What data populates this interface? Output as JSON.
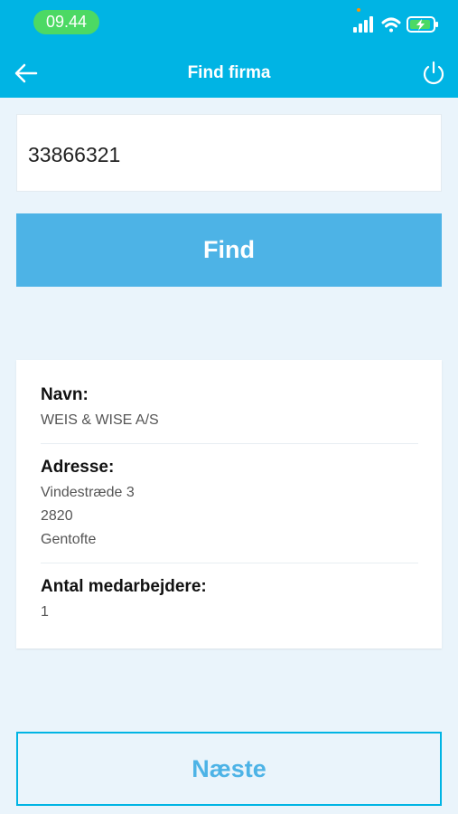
{
  "status_bar": {
    "time": "09.44",
    "icons": [
      "signal-icon",
      "wifi-icon",
      "battery-charging-icon"
    ],
    "time_pill_color": "#4cd964"
  },
  "header": {
    "title": "Find firma",
    "back_icon": "back-arrow-icon",
    "power_icon": "power-icon",
    "background": "#00b4e4"
  },
  "search": {
    "value": "33866321",
    "button_label": "Find"
  },
  "result": {
    "name_label": "Navn:",
    "name_value": "WEIS & WISE A/S",
    "address_label": "Adresse:",
    "address_lines": [
      "Vindestræde 3",
      "2820",
      "Gentofte"
    ],
    "employees_label": "Antal medarbejdere:",
    "employees_value": "1"
  },
  "footer": {
    "next_label": "Næste"
  }
}
